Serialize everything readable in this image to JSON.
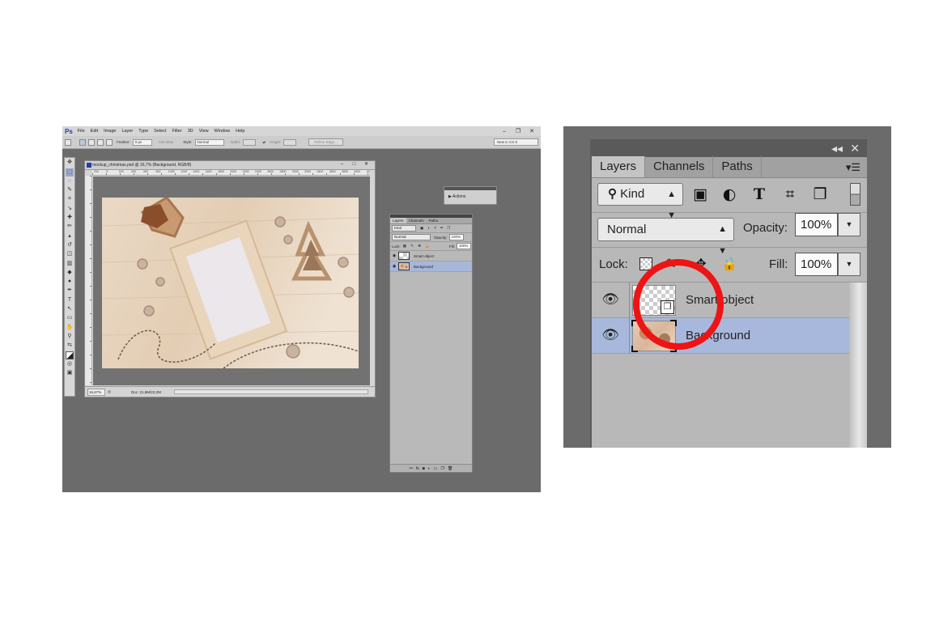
{
  "left_screenshot": {
    "app_logo": "Ps",
    "menu": [
      "File",
      "Edit",
      "Image",
      "Layer",
      "Type",
      "Select",
      "Filter",
      "3D",
      "View",
      "Window",
      "Help"
    ],
    "options_bar": {
      "feather_label": "Feather:",
      "feather_value": "0 px",
      "antialias_label": "Anti-alias",
      "style_label": "Style:",
      "style_value": "Normal",
      "width_label": "Width:",
      "height_label": "Height:",
      "refine_edge": "Refine Edge...",
      "workspace": "New in CS 6"
    },
    "document": {
      "title": "mockup_christmas.psd @ 16,7% (Background, RGB/8)",
      "ruler_ticks": [
        "200",
        "0",
        "200",
        "400",
        "600",
        "800",
        "1000",
        "1200",
        "1400",
        "1600",
        "1800",
        "2000",
        "2200",
        "2400",
        "2600",
        "2800",
        "3000",
        "3200",
        "3400",
        "3600",
        "3800",
        "4000",
        "42"
      ],
      "zoom": "16,67%",
      "doc_info": "Doc: 21,9M/22,2M"
    },
    "actions_panel": {
      "label": "Actions"
    },
    "mini_layers": {
      "tabs": [
        "Layers",
        "Channels",
        "Paths"
      ],
      "kind": "Kind",
      "blend_mode": "Normal",
      "opacity_label": "Opacity:",
      "opacity_value": "100%",
      "lock_label": "Lock:",
      "fill_label": "Fill:",
      "fill_value": "100%",
      "layers": [
        {
          "name": "Smart object",
          "selected": false
        },
        {
          "name": "Background",
          "selected": true
        }
      ]
    }
  },
  "zoomed_panel": {
    "tabs": [
      "Layers",
      "Channels",
      "Paths"
    ],
    "active_tab": "Layers",
    "filter": {
      "kind_label": "Kind",
      "icons": [
        "image-filter-icon",
        "adjustment-filter-icon",
        "type-filter-icon",
        "shape-filter-icon",
        "smart-object-filter-icon"
      ]
    },
    "blend_mode": "Normal",
    "opacity_label": "Opacity:",
    "opacity_value": "100%",
    "lock_label": "Lock:",
    "lock_icons": [
      "lock-transparent-icon",
      "lock-paint-icon",
      "lock-position-icon",
      "lock-all-icon"
    ],
    "fill_label": "Fill:",
    "fill_value": "100%",
    "layers": [
      {
        "name": "Smart object",
        "visible": true,
        "selected": false
      },
      {
        "name": "Background",
        "visible": true,
        "selected": true
      }
    ]
  },
  "colors": {
    "ps_background": "#6b6b6b",
    "selected_layer": "#a8b8dc",
    "highlight_circle": "#ee1414"
  }
}
